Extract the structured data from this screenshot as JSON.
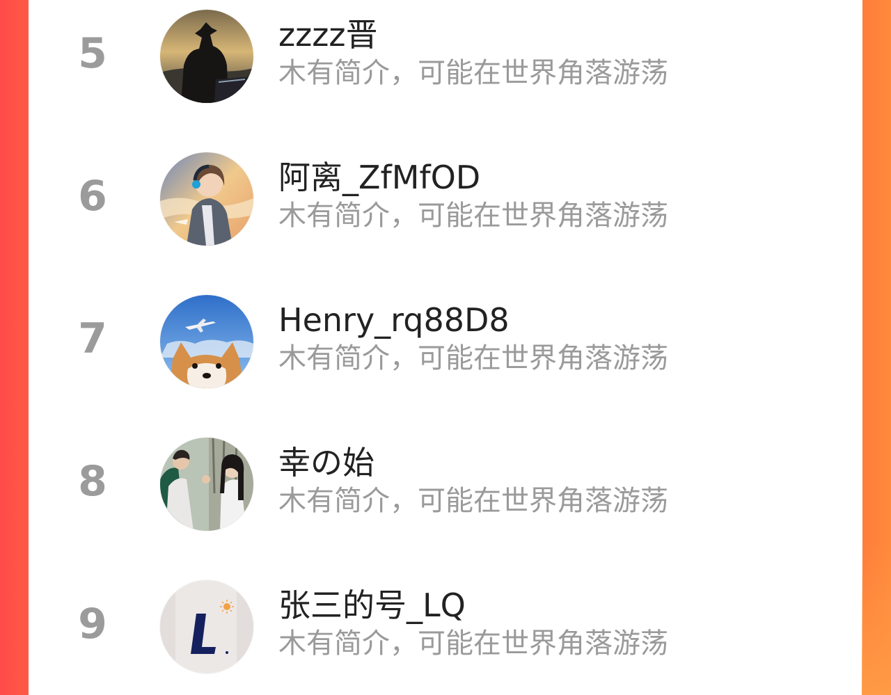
{
  "colors": {
    "background_gradient_start": "#ff4a4a",
    "background_gradient_end": "#ff8a3c",
    "card": "#ffffff",
    "rank_text": "#9b9b9b",
    "name_text": "#222222",
    "bio_text": "#9a9a9a"
  },
  "users": [
    {
      "rank": "5",
      "name": "zzzz晋",
      "bio": "木有简介，可能在世界角落游荡",
      "avatar_icon": "cowboy-silhouette-avatar"
    },
    {
      "rank": "6",
      "name": "阿离_ZfMfOD",
      "bio": "木有简介，可能在世界角落游荡",
      "avatar_icon": "anime-headphones-avatar"
    },
    {
      "rank": "7",
      "name": "Henry_rq88D8",
      "bio": "木有简介，可能在世界角落游荡",
      "avatar_icon": "shiba-airplane-avatar"
    },
    {
      "rank": "8",
      "name": "幸の始",
      "bio": "木有简介，可能在世界角落游荡",
      "avatar_icon": "couple-photo-avatar"
    },
    {
      "rank": "9",
      "name": "张三的号_LQ",
      "bio": "木有简介，可能在世界角落游荡",
      "avatar_icon": "letter-l-sun-avatar"
    }
  ]
}
